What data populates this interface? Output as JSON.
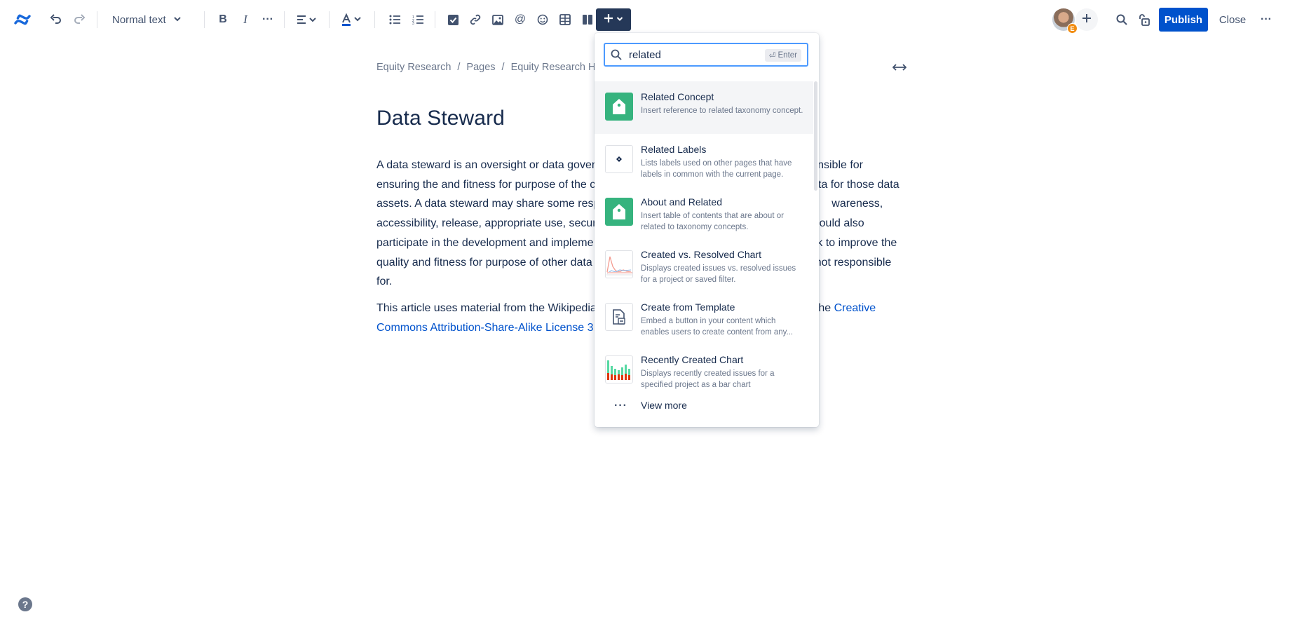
{
  "toolbar": {
    "text_style": "Normal text",
    "publish_label": "Publish",
    "close_label": "Close",
    "avatar_badge": "E",
    "icons": [
      "confluence-logo-icon",
      "undo-icon",
      "redo-icon",
      "bold-icon",
      "italic-icon",
      "more-formatting-icon",
      "alignment-icon",
      "text-color-icon",
      "bullet-list-icon",
      "numbered-list-icon",
      "action-item-icon",
      "link-icon",
      "image-icon",
      "mention-icon",
      "emoji-icon",
      "table-icon",
      "layouts-icon",
      "insert-icon",
      "search-icon",
      "restrictions-icon",
      "more-icon"
    ]
  },
  "breadcrumb": {
    "items": [
      "Equity Research",
      "Pages",
      "Equity Research Hom"
    ],
    "separator": "/"
  },
  "page": {
    "title": "Data Steward",
    "paragraph1": "A data steward is an oversight or data gover",
    "paragraph1_b": "onsible for",
    "line2a": "ensuring the  and fitness for purpose of the c",
    "line2b": "data for those data",
    "line3a": "assets. A data steward may share some respo",
    "line3b": "wareness,",
    "line4a": "accessibility, release, appropriate use, securit",
    "line4b": "ould also",
    "line5a": "participate in the development and impleme",
    "line5b": "ek to improve the",
    "line6a": "quality and fitness for purpose of other data",
    "line6b": "not responsible",
    "line7": "for.",
    "p2_a": "This article uses material from the Wikipedia",
    "p2_b": "the ",
    "p2_link1": "Creative",
    "p2_link2": "Commons Attribution-Share-Alike License 3."
  },
  "insert_menu": {
    "search_value": "related",
    "enter_hint": "Enter",
    "items": [
      {
        "title": "Related Concept",
        "description": "Insert reference to related taxonomy concept.",
        "icon": "taxonomy-tag-icon"
      },
      {
        "title": "Related Labels",
        "description": "Lists labels used on other pages that have labels in common with the current page.",
        "icon": "labels-icon"
      },
      {
        "title": "About and Related",
        "description": "Insert table of contents that are about or related to taxonomy concepts.",
        "icon": "taxonomy-tag-icon"
      },
      {
        "title": "Created vs. Resolved Chart",
        "description": "Displays created issues vs. resolved issues for a project or saved filter.",
        "icon": "line-chart-icon"
      },
      {
        "title": "Create from Template",
        "description": "Embed a button in your content which enables users to create content from any...",
        "icon": "template-icon"
      },
      {
        "title": "Recently Created Chart",
        "description": "Displays recently created issues for a specified project as a bar chart",
        "icon": "bar-chart-icon"
      }
    ],
    "view_more": "View more"
  },
  "colors": {
    "primary": "#0052cc",
    "insert_button": "#253858",
    "taxonomy_green": "#36b37e",
    "text": "#172b4d",
    "subtle_text": "#6b778c"
  }
}
